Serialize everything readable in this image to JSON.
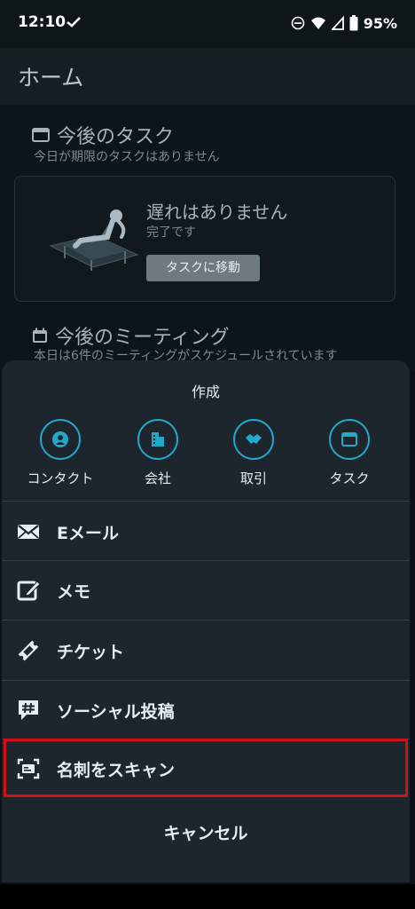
{
  "status_bar": {
    "time": "12:10",
    "battery": "95%",
    "icons": [
      "check-icon",
      "dnd-icon",
      "wifi-icon",
      "signal-icon",
      "battery-icon"
    ]
  },
  "app_bar": {
    "title": "ホーム"
  },
  "background": {
    "tasks_title": "今後のタスク",
    "tasks_sub": "今日が期限のタスクはありません",
    "card_heading": "遅れはありません",
    "card_sub": "完了です",
    "card_button": "タスクに移動",
    "meetings_title": "今後のミーティング",
    "meetings_sub": "本日は6件のミーティングがスケジュールされています"
  },
  "sheet": {
    "header": "作成",
    "quick_actions": [
      {
        "label": "コンタクト",
        "icon": "contact-icon"
      },
      {
        "label": "会社",
        "icon": "company-icon"
      },
      {
        "label": "取引",
        "icon": "deal-icon"
      },
      {
        "label": "タスク",
        "icon": "task-icon"
      }
    ],
    "menu_items": [
      {
        "label": "Eメール",
        "icon": "email-icon"
      },
      {
        "label": "メモ",
        "icon": "note-icon"
      },
      {
        "label": "チケット",
        "icon": "ticket-icon"
      },
      {
        "label": "ソーシャル投稿",
        "icon": "social-post-icon"
      },
      {
        "label": "名刺をスキャン",
        "icon": "scan-card-icon"
      }
    ],
    "cancel": "キャンセル"
  },
  "colors": {
    "accent": "#22a8c9",
    "highlight": "#d40f16",
    "sheet_bg": "#1d262c"
  }
}
